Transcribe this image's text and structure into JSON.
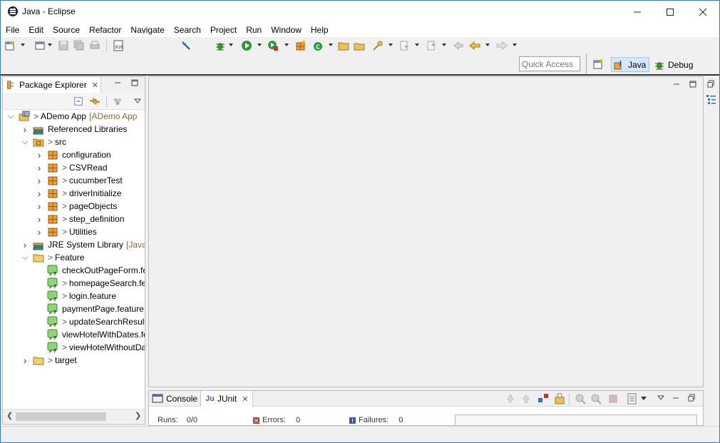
{
  "window": {
    "title": "Java - Eclipse"
  },
  "menu": [
    "File",
    "Edit",
    "Source",
    "Refactor",
    "Navigate",
    "Search",
    "Project",
    "Run",
    "Window",
    "Help"
  ],
  "quick_access": {
    "placeholder": "Quick Access"
  },
  "perspectives": {
    "java": "Java",
    "debug": "Debug"
  },
  "package_explorer": {
    "title": "Package Explorer",
    "tree": [
      {
        "label": "ADemo App",
        "prefix": "> ",
        "decoration": "[ADemo App",
        "icon": "project-icon",
        "depth": 0,
        "expanded": true
      },
      {
        "label": "Referenced Libraries",
        "prefix": "",
        "decoration": "",
        "icon": "library-icon",
        "depth": 1,
        "expanded": false
      },
      {
        "label": "src",
        "prefix": "> ",
        "decoration": "",
        "icon": "source-folder-icon",
        "depth": 1,
        "expanded": true
      },
      {
        "label": "configuration",
        "prefix": "",
        "decoration": "",
        "icon": "package-icon",
        "depth": 2,
        "expanded": false
      },
      {
        "label": "CSVRead",
        "prefix": "> ",
        "decoration": "",
        "icon": "package-icon",
        "depth": 2,
        "expanded": false
      },
      {
        "label": "cucumberTest",
        "prefix": "> ",
        "decoration": "",
        "icon": "package-icon",
        "depth": 2,
        "expanded": false
      },
      {
        "label": "driverInitialize",
        "prefix": "> ",
        "decoration": "",
        "icon": "package-icon",
        "depth": 2,
        "expanded": false
      },
      {
        "label": "pageObjects",
        "prefix": "> ",
        "decoration": "",
        "icon": "package-icon",
        "depth": 2,
        "expanded": false
      },
      {
        "label": "step_definition",
        "prefix": "> ",
        "decoration": "",
        "icon": "package-icon",
        "depth": 2,
        "expanded": false
      },
      {
        "label": "Utilities",
        "prefix": "> ",
        "decoration": "",
        "icon": "package-icon",
        "depth": 2,
        "expanded": false
      },
      {
        "label": "JRE System Library",
        "prefix": "",
        "decoration": "[JavaSE",
        "icon": "library-icon",
        "depth": 1,
        "expanded": false
      },
      {
        "label": "Feature",
        "prefix": "> ",
        "decoration": "",
        "icon": "folder-icon",
        "depth": 1,
        "expanded": true
      },
      {
        "label": "checkOutPageForm.feature",
        "prefix": "",
        "decoration": "",
        "icon": "feature-file-icon",
        "depth": 2,
        "leaf": true
      },
      {
        "label": "homepageSearch.feature",
        "prefix": "> ",
        "decoration": "",
        "icon": "feature-file-icon",
        "depth": 2,
        "leaf": true
      },
      {
        "label": "login.feature",
        "prefix": "> ",
        "decoration": "",
        "icon": "feature-file-icon",
        "depth": 2,
        "leaf": true
      },
      {
        "label": "paymentPage.feature",
        "prefix": "",
        "decoration": "",
        "icon": "feature-file-icon",
        "depth": 2,
        "leaf": true
      },
      {
        "label": "updateSearchResult.feature",
        "prefix": "> ",
        "decoration": "",
        "icon": "feature-file-icon",
        "depth": 2,
        "leaf": true
      },
      {
        "label": "viewHotelWithDates.feature",
        "prefix": "",
        "decoration": "",
        "icon": "feature-file-icon",
        "depth": 2,
        "leaf": true
      },
      {
        "label": "viewHotelWithoutDates.feature",
        "prefix": "> ",
        "decoration": "",
        "icon": "feature-file-icon",
        "depth": 2,
        "leaf": true
      },
      {
        "label": "target",
        "prefix": "> ",
        "decoration": "",
        "icon": "folder-icon",
        "depth": 1,
        "expanded": false
      }
    ]
  },
  "bottom": {
    "console_tab": "Console",
    "junit_tab": "JUnit",
    "runs_label": "Runs:",
    "runs_value": "0/0",
    "errors_label": "Errors:",
    "errors_value": "0",
    "failures_label": "Failures:",
    "failures_value": "0"
  },
  "colors": {
    "accent": "#3c78c8",
    "selected_perspective": "#d6e6f7",
    "decoration": "#8a6b3a"
  }
}
